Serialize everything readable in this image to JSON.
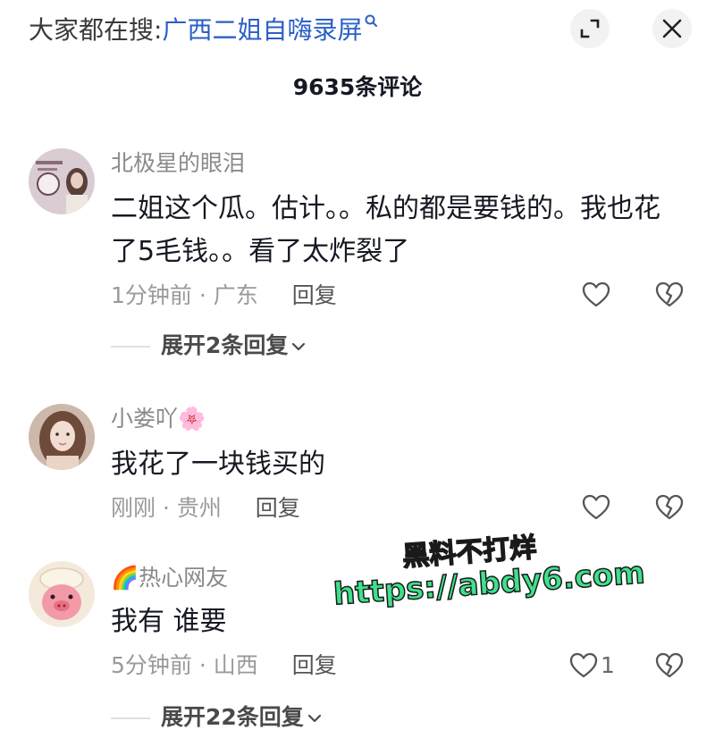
{
  "search": {
    "prefix": "大家都在搜:",
    "term": "广西二姐自嗨录屏"
  },
  "header": {
    "comment_count": "9635条评论"
  },
  "comments": [
    {
      "username": "北极星的眼泪",
      "text": "二姐这个瓜。估计。。私的都是要钱的。我也花了5毛钱。。看了太炸裂了",
      "time_location": "1分钟前 · 广东",
      "reply_label": "回复",
      "like_count": "",
      "expand_label": "展开2条回复"
    },
    {
      "username": "小娄吖",
      "username_emoji": "🌸",
      "text": "我花了一块钱买的",
      "time_location": "刚刚 · 贵州",
      "reply_label": "回复",
      "like_count": ""
    },
    {
      "username": "热心网友",
      "username_emoji": "🌈",
      "text": "我有 谁要",
      "time_location": "5分钟前 · 山西",
      "reply_label": "回复",
      "like_count": "1",
      "expand_label": "展开22条回复"
    }
  ],
  "watermark": {
    "line1": "黑料不打烊",
    "line2": "https://abdy6.com"
  },
  "colors": {
    "link": "#2a5fc7",
    "watermark": "#3ee08c",
    "meta": "#9a9a9a"
  }
}
